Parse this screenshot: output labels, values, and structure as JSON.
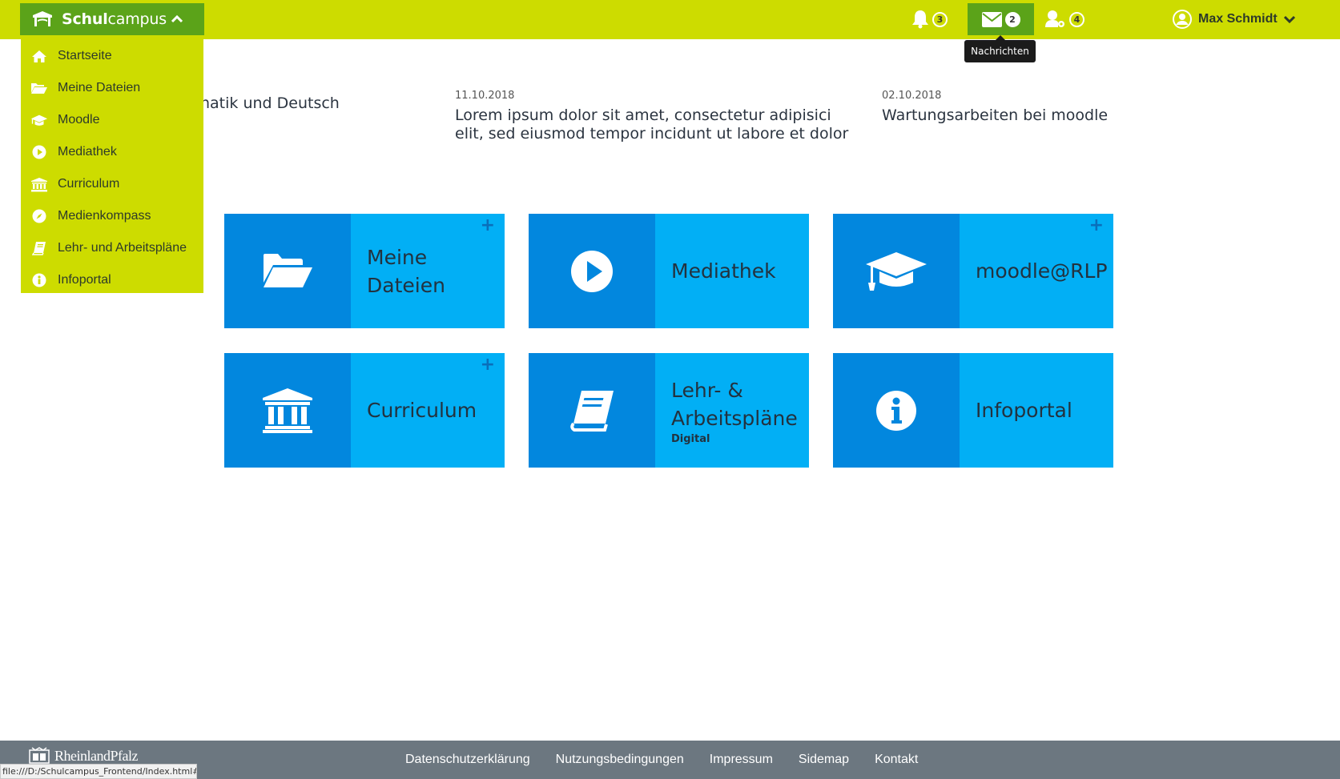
{
  "brand": {
    "name_bold": "Schul",
    "name_rest": "campus"
  },
  "header": {
    "notifications_count": "3",
    "messages_count": "2",
    "messages_tooltip": "Nachrichten",
    "user_requests_count": "4",
    "user_name": "Max Schmidt"
  },
  "menu": {
    "items": [
      {
        "label": "Startseite",
        "icon": "home-icon"
      },
      {
        "label": "Meine Dateien",
        "icon": "folder-open-icon"
      },
      {
        "label": "Moodle",
        "icon": "graduation-cap-icon"
      },
      {
        "label": "Mediathek",
        "icon": "play-circle-icon"
      },
      {
        "label": "Curriculum",
        "icon": "institution-icon"
      },
      {
        "label": "Medienkompass",
        "icon": "compass-icon"
      },
      {
        "label": "Lehr- und Arbeitspläne",
        "icon": "book-icon"
      },
      {
        "label": "Infoportal",
        "icon": "info-circle-icon"
      }
    ]
  },
  "news": [
    {
      "date": "",
      "title": "natik und Deutsch"
    },
    {
      "date": "11.10.2018",
      "title": "Lorem ipsum dolor sit amet, consectetur adipisici elit, sed eiusmod tempor incidunt ut labore et dolor"
    },
    {
      "date": "02.10.2018",
      "title": "Wartungsarbeiten bei moodle"
    }
  ],
  "tiles": [
    {
      "label": "Meine Dateien",
      "sub": "",
      "icon": "folder-open-icon",
      "plus": "+"
    },
    {
      "label": "Mediathek",
      "sub": "",
      "icon": "play-circle-icon",
      "plus": ""
    },
    {
      "label": "moodle@RLP",
      "sub": "",
      "icon": "graduation-cap-icon",
      "plus": "+"
    },
    {
      "label": "Curriculum",
      "sub": "",
      "icon": "institution-icon",
      "plus": "+"
    },
    {
      "label": "Lehr- & Arbeitspläne",
      "sub": "Digital",
      "icon": "book-icon",
      "plus": ""
    },
    {
      "label": "Infoportal",
      "sub": "",
      "icon": "info-circle-icon",
      "plus": ""
    }
  ],
  "footer": {
    "logo_text": "RheinlandPfalz",
    "links": [
      "Datenschutzerklärung",
      "Nutzungsbedingungen",
      "Impressum",
      "Sidemap",
      "Kontakt"
    ]
  },
  "status_bar": {
    "url": "file:///D:/Schulcampus_Frontend/Index.html#"
  },
  "colors": {
    "topbar": "#cddc00",
    "brand": "#5ba319",
    "tile_dark": "#0287de",
    "tile_light": "#02aff5",
    "footer": "#6c7780"
  }
}
